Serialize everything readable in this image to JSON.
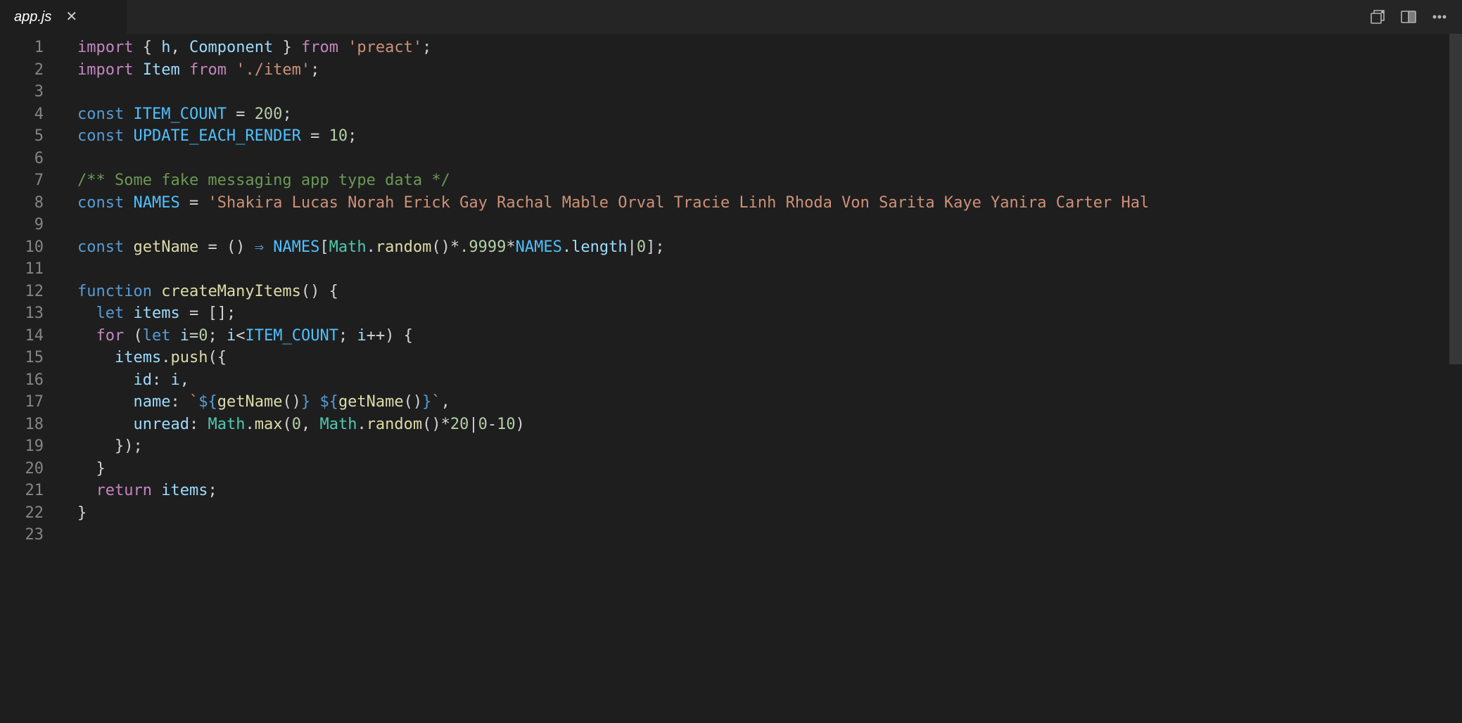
{
  "tab": {
    "filename": "app.js",
    "italic": true
  },
  "icons": {
    "compare": "compare-changes-icon",
    "split": "split-editor-icon",
    "more": "more-icon"
  },
  "code": {
    "lines": [
      {
        "n": 1,
        "tokens": [
          {
            "t": "import",
            "c": "kw"
          },
          {
            "t": " { ",
            "c": "pn"
          },
          {
            "t": "h",
            "c": "var"
          },
          {
            "t": ", ",
            "c": "pn"
          },
          {
            "t": "Component",
            "c": "var"
          },
          {
            "t": " } ",
            "c": "pn"
          },
          {
            "t": "from",
            "c": "kw"
          },
          {
            "t": " ",
            "c": "pn"
          },
          {
            "t": "'preact'",
            "c": "str"
          },
          {
            "t": ";",
            "c": "pn"
          }
        ]
      },
      {
        "n": 2,
        "tokens": [
          {
            "t": "import",
            "c": "kw"
          },
          {
            "t": " ",
            "c": "pn"
          },
          {
            "t": "Item",
            "c": "var"
          },
          {
            "t": " ",
            "c": "pn"
          },
          {
            "t": "from",
            "c": "kw"
          },
          {
            "t": " ",
            "c": "pn"
          },
          {
            "t": "'./item'",
            "c": "str"
          },
          {
            "t": ";",
            "c": "pn"
          }
        ]
      },
      {
        "n": 3,
        "tokens": []
      },
      {
        "n": 4,
        "tokens": [
          {
            "t": "const",
            "c": "blue"
          },
          {
            "t": " ",
            "c": "pn"
          },
          {
            "t": "ITEM_COUNT",
            "c": "const"
          },
          {
            "t": " = ",
            "c": "pn"
          },
          {
            "t": "200",
            "c": "num"
          },
          {
            "t": ";",
            "c": "pn"
          }
        ]
      },
      {
        "n": 5,
        "tokens": [
          {
            "t": "const",
            "c": "blue"
          },
          {
            "t": " ",
            "c": "pn"
          },
          {
            "t": "UPDATE_EACH_RENDER",
            "c": "const"
          },
          {
            "t": " = ",
            "c": "pn"
          },
          {
            "t": "10",
            "c": "num"
          },
          {
            "t": ";",
            "c": "pn"
          }
        ]
      },
      {
        "n": 6,
        "tokens": []
      },
      {
        "n": 7,
        "tokens": [
          {
            "t": "/** Some fake messaging app type data */",
            "c": "cmt"
          }
        ]
      },
      {
        "n": 8,
        "tokens": [
          {
            "t": "const",
            "c": "blue"
          },
          {
            "t": " ",
            "c": "pn"
          },
          {
            "t": "NAMES",
            "c": "const"
          },
          {
            "t": " = ",
            "c": "pn"
          },
          {
            "t": "'Shakira Lucas Norah Erick Gay Rachal Mable Orval Tracie Linh Rhoda Von Sarita Kaye Yanira Carter Hal",
            "c": "str"
          }
        ]
      },
      {
        "n": 9,
        "tokens": []
      },
      {
        "n": 10,
        "tokens": [
          {
            "t": "const",
            "c": "blue"
          },
          {
            "t": " ",
            "c": "pn"
          },
          {
            "t": "getName",
            "c": "fn"
          },
          {
            "t": " = () ",
            "c": "pn"
          },
          {
            "t": "⇒",
            "c": "blue"
          },
          {
            "t": " ",
            "c": "pn"
          },
          {
            "t": "NAMES",
            "c": "const"
          },
          {
            "t": "[",
            "c": "pn"
          },
          {
            "t": "Math",
            "c": "type"
          },
          {
            "t": ".",
            "c": "pn"
          },
          {
            "t": "random",
            "c": "fn"
          },
          {
            "t": "()*",
            "c": "pn"
          },
          {
            "t": ".9999",
            "c": "num"
          },
          {
            "t": "*",
            "c": "pn"
          },
          {
            "t": "NAMES",
            "c": "const"
          },
          {
            "t": ".",
            "c": "pn"
          },
          {
            "t": "length",
            "c": "var"
          },
          {
            "t": "|",
            "c": "pn"
          },
          {
            "t": "0",
            "c": "num"
          },
          {
            "t": "];",
            "c": "pn"
          }
        ]
      },
      {
        "n": 11,
        "tokens": []
      },
      {
        "n": 12,
        "tokens": [
          {
            "t": "function",
            "c": "blue"
          },
          {
            "t": " ",
            "c": "pn"
          },
          {
            "t": "createManyItems",
            "c": "fn"
          },
          {
            "t": "() {",
            "c": "pn"
          }
        ]
      },
      {
        "n": 13,
        "tokens": [
          {
            "t": "  ",
            "c": "pn"
          },
          {
            "t": "let",
            "c": "blue"
          },
          {
            "t": " ",
            "c": "pn"
          },
          {
            "t": "items",
            "c": "var"
          },
          {
            "t": " = [];",
            "c": "pn"
          }
        ]
      },
      {
        "n": 14,
        "tokens": [
          {
            "t": "  ",
            "c": "pn"
          },
          {
            "t": "for",
            "c": "kw"
          },
          {
            "t": " (",
            "c": "pn"
          },
          {
            "t": "let",
            "c": "blue"
          },
          {
            "t": " ",
            "c": "pn"
          },
          {
            "t": "i",
            "c": "var"
          },
          {
            "t": "=",
            "c": "pn"
          },
          {
            "t": "0",
            "c": "num"
          },
          {
            "t": "; ",
            "c": "pn"
          },
          {
            "t": "i",
            "c": "var"
          },
          {
            "t": "<",
            "c": "pn"
          },
          {
            "t": "ITEM_COUNT",
            "c": "const"
          },
          {
            "t": "; ",
            "c": "pn"
          },
          {
            "t": "i",
            "c": "var"
          },
          {
            "t": "++) {",
            "c": "pn"
          }
        ]
      },
      {
        "n": 15,
        "tokens": [
          {
            "t": "    ",
            "c": "pn"
          },
          {
            "t": "items",
            "c": "var"
          },
          {
            "t": ".",
            "c": "pn"
          },
          {
            "t": "push",
            "c": "fn"
          },
          {
            "t": "({",
            "c": "pn"
          }
        ]
      },
      {
        "n": 16,
        "tokens": [
          {
            "t": "      ",
            "c": "pn"
          },
          {
            "t": "id",
            "c": "var"
          },
          {
            "t": ": ",
            "c": "pn"
          },
          {
            "t": "i",
            "c": "var"
          },
          {
            "t": ",",
            "c": "pn"
          }
        ]
      },
      {
        "n": 17,
        "tokens": [
          {
            "t": "      ",
            "c": "pn"
          },
          {
            "t": "name",
            "c": "var"
          },
          {
            "t": ": ",
            "c": "pn"
          },
          {
            "t": "`",
            "c": "str"
          },
          {
            "t": "${",
            "c": "blue"
          },
          {
            "t": "getName",
            "c": "fn"
          },
          {
            "t": "()",
            "c": "pn"
          },
          {
            "t": "}",
            "c": "blue"
          },
          {
            "t": " ",
            "c": "str"
          },
          {
            "t": "${",
            "c": "blue"
          },
          {
            "t": "getName",
            "c": "fn"
          },
          {
            "t": "()",
            "c": "pn"
          },
          {
            "t": "}",
            "c": "blue"
          },
          {
            "t": "`",
            "c": "str"
          },
          {
            "t": ",",
            "c": "pn"
          }
        ]
      },
      {
        "n": 18,
        "tokens": [
          {
            "t": "      ",
            "c": "pn"
          },
          {
            "t": "unread",
            "c": "var"
          },
          {
            "t": ": ",
            "c": "pn"
          },
          {
            "t": "Math",
            "c": "type"
          },
          {
            "t": ".",
            "c": "pn"
          },
          {
            "t": "max",
            "c": "fn"
          },
          {
            "t": "(",
            "c": "pn"
          },
          {
            "t": "0",
            "c": "num"
          },
          {
            "t": ", ",
            "c": "pn"
          },
          {
            "t": "Math",
            "c": "type"
          },
          {
            "t": ".",
            "c": "pn"
          },
          {
            "t": "random",
            "c": "fn"
          },
          {
            "t": "()*",
            "c": "pn"
          },
          {
            "t": "20",
            "c": "num"
          },
          {
            "t": "|",
            "c": "pn"
          },
          {
            "t": "0",
            "c": "num"
          },
          {
            "t": "-",
            "c": "pn"
          },
          {
            "t": "10",
            "c": "num"
          },
          {
            "t": ")",
            "c": "pn"
          }
        ]
      },
      {
        "n": 19,
        "tokens": [
          {
            "t": "    });",
            "c": "pn"
          }
        ]
      },
      {
        "n": 20,
        "tokens": [
          {
            "t": "  }",
            "c": "pn"
          }
        ]
      },
      {
        "n": 21,
        "tokens": [
          {
            "t": "  ",
            "c": "pn"
          },
          {
            "t": "return",
            "c": "kw"
          },
          {
            "t": " ",
            "c": "pn"
          },
          {
            "t": "items",
            "c": "var"
          },
          {
            "t": ";",
            "c": "pn"
          }
        ]
      },
      {
        "n": 22,
        "tokens": [
          {
            "t": "}",
            "c": "pn"
          }
        ]
      },
      {
        "n": 23,
        "tokens": []
      }
    ]
  }
}
